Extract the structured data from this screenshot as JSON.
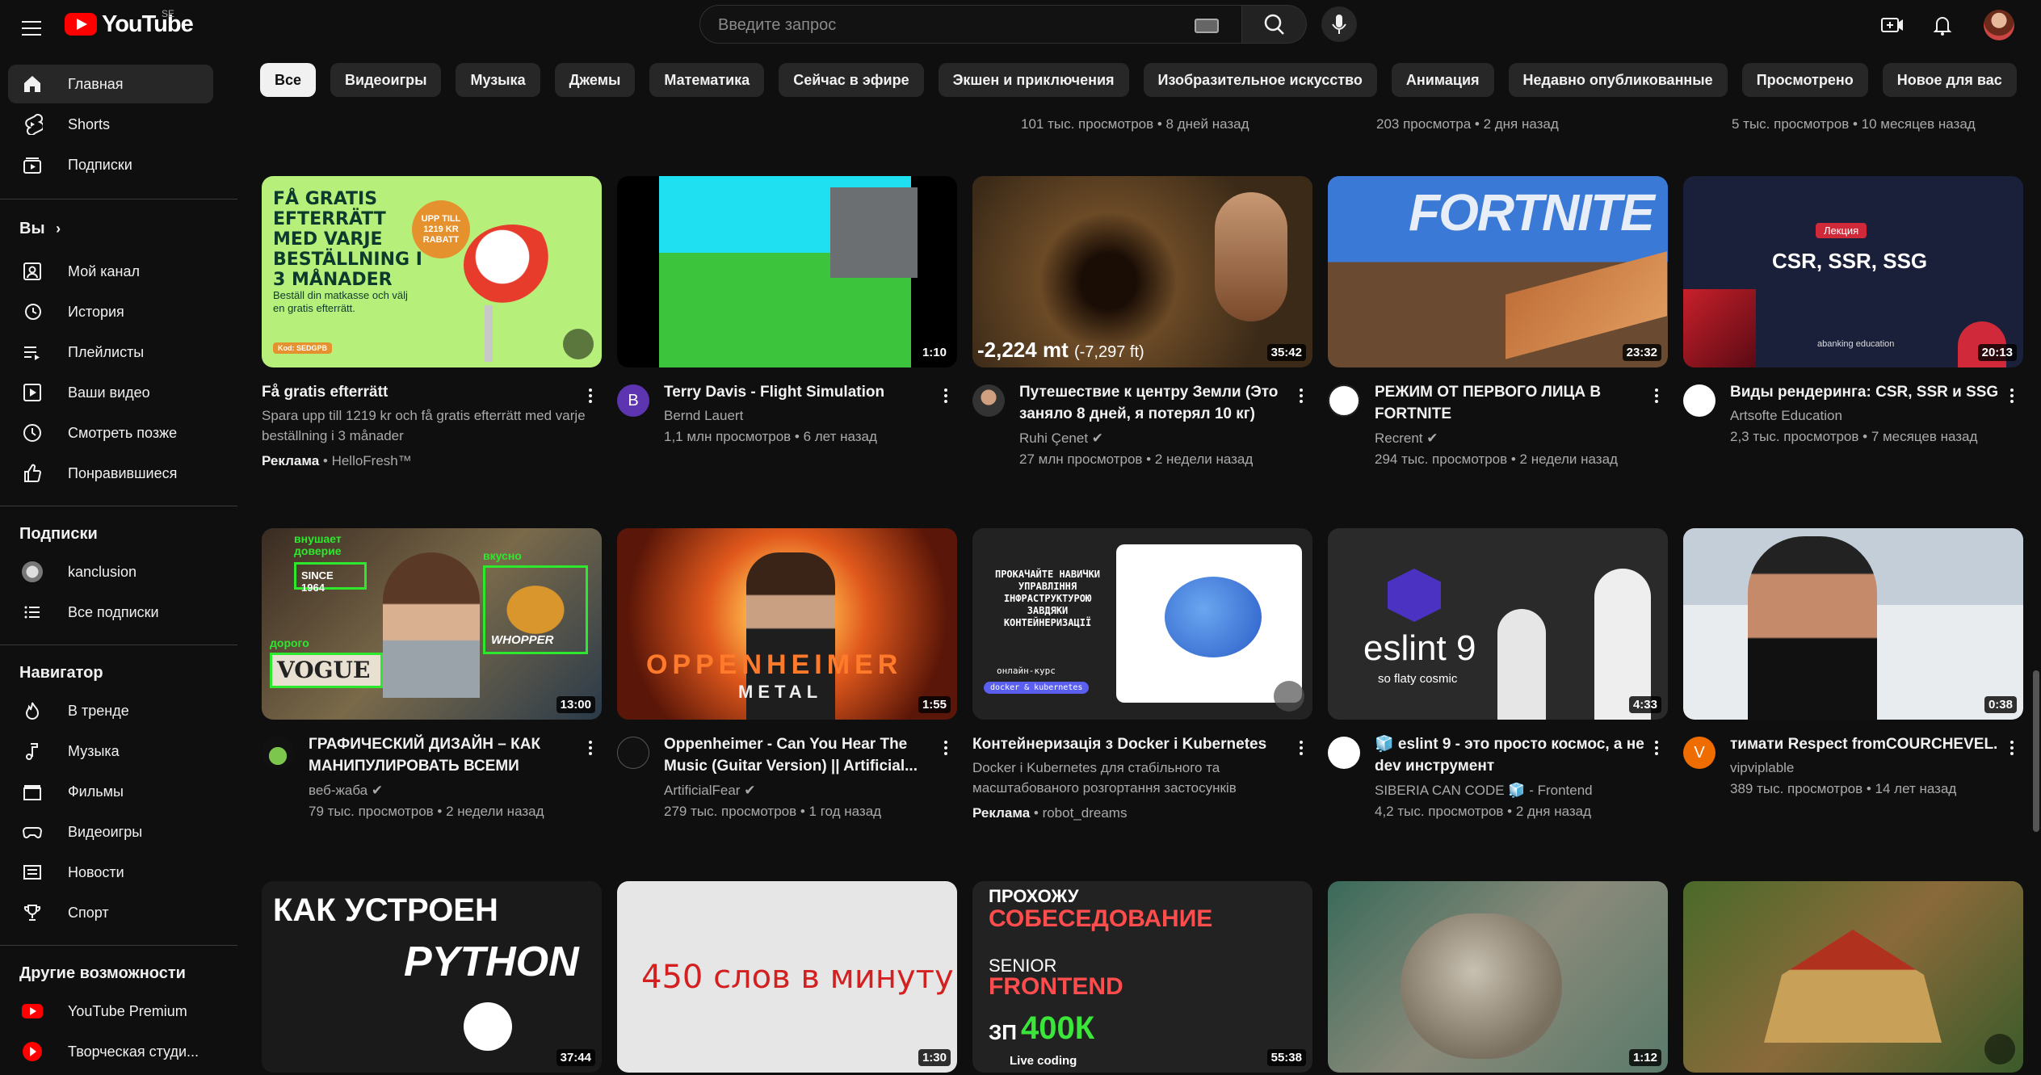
{
  "header": {
    "logo_text": "YouTube",
    "country_code": "SE",
    "search_placeholder": "Введите запрос"
  },
  "chips": [
    "Все",
    "Видеоигры",
    "Музыка",
    "Джемы",
    "Математика",
    "Сейчас в эфире",
    "Экшен и приключения",
    "Изобразительное искусство",
    "Анимация",
    "Недавно опубликованные",
    "Просмотрено",
    "Новое для вас"
  ],
  "sidebar": {
    "main": [
      {
        "label": "Главная",
        "icon": "home-icon"
      },
      {
        "label": "Shorts",
        "icon": "shorts-icon"
      },
      {
        "label": "Подписки",
        "icon": "subscriptions-icon"
      }
    ],
    "you_heading": "Вы",
    "you": [
      {
        "label": "Мой канал",
        "icon": "channel-icon"
      },
      {
        "label": "История",
        "icon": "history-icon"
      },
      {
        "label": "Плейлисты",
        "icon": "playlists-icon"
      },
      {
        "label": "Ваши видео",
        "icon": "your-videos-icon"
      },
      {
        "label": "Смотреть позже",
        "icon": "watch-later-icon"
      },
      {
        "label": "Понравившиеся",
        "icon": "liked-icon"
      }
    ],
    "subs_heading": "Подписки",
    "subs": [
      {
        "label": "kanclusion",
        "icon": "channel-avatar"
      },
      {
        "label": "Все подписки",
        "icon": "list-icon"
      }
    ],
    "nav_heading": "Навигатор",
    "nav": [
      {
        "label": "В тренде",
        "icon": "trending-icon"
      },
      {
        "label": "Музыка",
        "icon": "music-icon"
      },
      {
        "label": "Фильмы",
        "icon": "movies-icon"
      },
      {
        "label": "Видеоигры",
        "icon": "gaming-icon"
      },
      {
        "label": "Новости",
        "icon": "news-icon"
      },
      {
        "label": "Спорт",
        "icon": "sports-icon"
      }
    ],
    "more_heading": "Другие возможности",
    "more": [
      {
        "label": "YouTube Premium",
        "icon": "youtube-premium-icon"
      },
      {
        "label": "Творческая студи...",
        "icon": "youtube-studio-icon"
      }
    ]
  },
  "partial_row": [
    "101 тыс. просмотров • 8 дней назад",
    "203 просмотра • 2 дня назад",
    "5 тыс. просмотров • 10 месяцев назад"
  ],
  "row1": [
    {
      "title": "Få gratis efterrätt",
      "desc": "Spara upp till 1219 kr och få gratis efterrätt med varje beställning i 3 månader",
      "ad_label": "Реклама",
      "advertiser": "HelloFresh™",
      "thumb_text": "FÅ GRATIS EFTERRÄTT MED VARJE BESTÄLLNING I 3 MÅNADER",
      "thumb_badge": "UPP TILL 1219 KR RABATT",
      "thumb_sub": "Beställ din matkasse och välj en gratis efterrätt.",
      "thumb_code": "Kod: SEDGPB"
    },
    {
      "title": "Terry Davis - Flight Simulation",
      "channel": "Bernd Lauert",
      "stats": "1,1 млн просмотров • 6 лет назад",
      "duration": "1:10",
      "avatar_letter": "B"
    },
    {
      "title": "Путешествие к центру Земли (Это заняло 8 дней, я потерял 10 кг)",
      "channel": "Ruhi Çenet",
      "stats": "27 млн просмотров • 2 недели назад",
      "duration": "35:42",
      "thumb_text": "-2,224 mt",
      "thumb_sub": "(-7,297 ft)"
    },
    {
      "title": "РЕЖИМ ОТ ПЕРВОГО ЛИЦА В FORTNITE",
      "channel": "Recrent",
      "stats": "294 тыс. просмотров • 2 недели назад",
      "duration": "23:32",
      "thumb_text": "FORTNITE"
    },
    {
      "title": "Виды рендеринга: CSR, SSR и SSG",
      "channel": "Artsofte Education",
      "stats": "2,3 тыс. просмотров • 7 месяцев назад",
      "duration": "20:13",
      "thumb_text": "CSR, SSR, SSG",
      "thumb_badge": "Лекция",
      "thumb_sub": "abanking education"
    }
  ],
  "row2": [
    {
      "title": "ГРАФИЧЕСКИЙ ДИЗАЙН – КАК МАНИПУЛИРОВАТЬ ВСЕМИ",
      "channel": "веб-жаба",
      "stats": "79 тыс. просмотров • 2 недели назад",
      "duration": "13:00",
      "thumb_tags": [
        "внушает доверие",
        "вкусно",
        "SINCE 1964",
        "дорого",
        "VOGUE",
        "WHOPPER"
      ]
    },
    {
      "title": "Oppenheimer - Can You Hear The Music (Guitar Version) || Artificial...",
      "channel": "ArtificialFear",
      "stats": "279 тыс. просмотров • 1 год назад",
      "duration": "1:55",
      "thumb_text": "OPPENHEIMER",
      "thumb_sub": "METAL"
    },
    {
      "title": "Контейнеризація з Docker і Kubernetes",
      "desc": "Docker і Kubernetes для стабільного та масштабованого розгортання застосунків",
      "ad_label": "Реклама",
      "advertiser": "robot_dreams",
      "thumb_text": "ПРОКАЧАЙТЕ НАВИЧКИ УПРАВЛІННЯ ІНФРАСТРУКТУРОЮ ЗАВДЯКИ КОНТЕЙНЕРИЗАЦІЇ",
      "thumb_sub": "онлайн-курс",
      "thumb_badge": "docker & kubernetes"
    },
    {
      "title": "🧊 eslint 9 - это просто космос, а не dev инструмент",
      "channel": "SIBERIA CAN CODE 🧊 - Frontend",
      "stats": "4,2 тыс. просмотров • 2 дня назад",
      "duration": "4:33",
      "thumb_text": "eslint 9",
      "thumb_sub": "so flaty cosmic"
    },
    {
      "title": "тимати Respect fromCOURCHEVEL.",
      "channel": "vipviplable",
      "stats": "389 тыс. просмотров • 14 лет назад",
      "duration": "0:38",
      "avatar_letter": "V"
    }
  ],
  "row3": [
    {
      "duration": "37:44",
      "thumb_text": "КАК УСТРОЕН",
      "thumb_sub": "PYTHON"
    },
    {
      "duration": "1:30",
      "thumb_text": "450 слов в минуту"
    },
    {
      "duration": "55:38",
      "thumb_text": "ПРОХОЖУ",
      "thumb_sub": "СОБЕСЕДОВАНИЕ",
      "thumb_extra": [
        "SENIOR",
        "FRONTEND",
        "ЗП",
        "400К",
        "Live coding"
      ]
    },
    {
      "duration": "1:12"
    },
    {
      "duration": ""
    }
  ],
  "colors": {
    "bg": "#0f0f0f",
    "chip": "#272727",
    "brand_red": "#ff0000",
    "meta_text": "#aaaaaa"
  }
}
